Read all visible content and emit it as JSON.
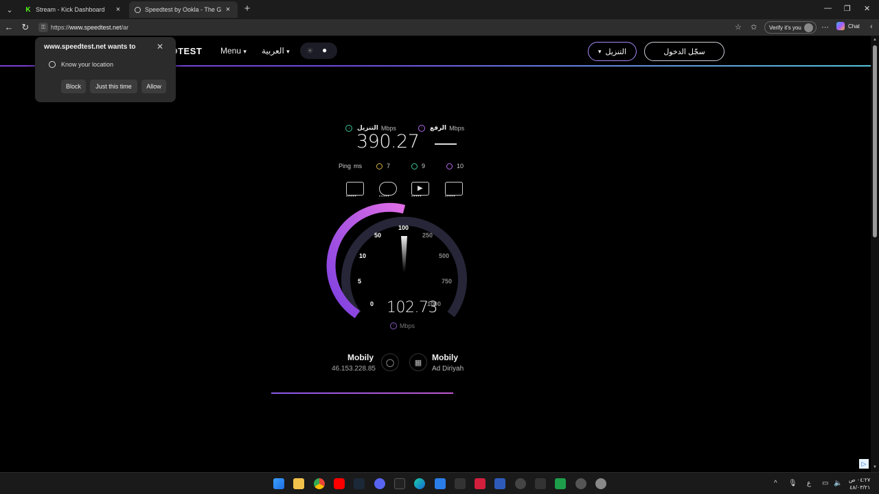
{
  "browser": {
    "tabs": [
      {
        "title": "Stream - Kick Dashboard",
        "favicon": "kick-icon",
        "active": false
      },
      {
        "title": "Speedtest by Ookla - The Global B",
        "favicon": "speedtest-icon",
        "active": true
      }
    ],
    "url_scheme": "https://",
    "url_host": "www.speedtest.net",
    "url_path": "/ar",
    "verify_label": "Verify it's you",
    "chat_label": "Chat"
  },
  "permission": {
    "title": "www.speedtest.net wants to",
    "request": "Know your location",
    "block": "Block",
    "once": "Just this time",
    "allow": "Allow"
  },
  "site": {
    "brand": "EDTEST",
    "menu": "Menu",
    "language": "العربية",
    "download_button": "التنزيل",
    "login_button": "سجّل الدخول"
  },
  "results": {
    "download_label": "التنزيل",
    "download_unit": "Mbps",
    "upload_label": "الرفع",
    "upload_unit": "Mbps",
    "download_value": "390.27",
    "ping_label": "Ping",
    "ping_unit": "ms",
    "ping_idle": "7",
    "ping_download": "9",
    "ping_upload": "10"
  },
  "gauge": {
    "ticks": [
      "0",
      "5",
      "10",
      "50",
      "100",
      "250",
      "500",
      "750",
      "1000"
    ],
    "value": "102.73",
    "unit": "Mbps",
    "colors": {
      "arc": "#b45ce6",
      "track": "#2a2a3e"
    }
  },
  "connection": {
    "isp_name": "Mobily",
    "ip": "46.153.228.85",
    "server_name": "Mobily",
    "server_location": "Ad Diriyah"
  },
  "taskbar": {
    "clock_time": "٠٤:٢٧ ص",
    "clock_date": "٤٨/٠٣/٢١",
    "lang_indicator": "ع"
  }
}
